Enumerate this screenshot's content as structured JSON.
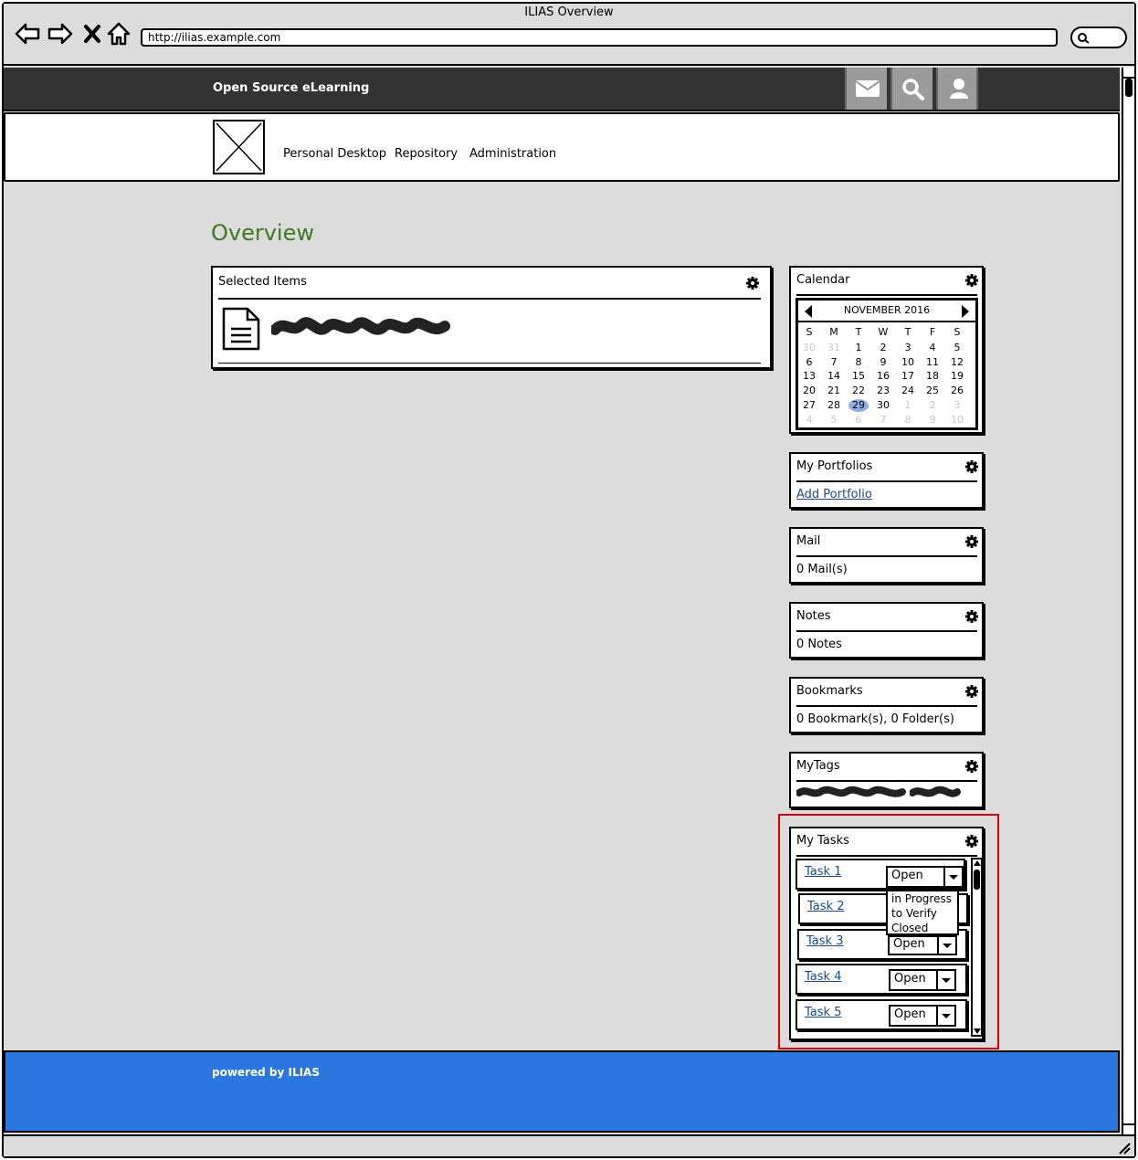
{
  "window": {
    "title": "ILIAS Overview"
  },
  "browser": {
    "url": "http://ilias.example.com"
  },
  "header": {
    "brand": "Open Source eLearning"
  },
  "menu": {
    "items": [
      "Personal Desktop",
      "Repository",
      "Administration"
    ]
  },
  "page": {
    "title": "Overview"
  },
  "selected_items": {
    "title": "Selected Items"
  },
  "calendar": {
    "title": "Calendar",
    "month": "NOVEMBER 2016",
    "weekdays": [
      "S",
      "M",
      "T",
      "W",
      "T",
      "F",
      "S"
    ],
    "weeks": [
      [
        "30",
        "31",
        "1",
        "2",
        "3",
        "4",
        "5"
      ],
      [
        "6",
        "7",
        "8",
        "9",
        "10",
        "11",
        "12"
      ],
      [
        "13",
        "14",
        "15",
        "16",
        "17",
        "18",
        "19"
      ],
      [
        "20",
        "21",
        "22",
        "23",
        "24",
        "25",
        "26"
      ],
      [
        "27",
        "28",
        "29",
        "30",
        "1",
        "2",
        "3"
      ],
      [
        "4",
        "5",
        "6",
        "7",
        "8",
        "9",
        "10"
      ]
    ],
    "today": "29"
  },
  "portfolios": {
    "title": "My Portfolios",
    "link": "Add Portfolio"
  },
  "mail": {
    "title": "Mail",
    "text": "0 Mail(s)"
  },
  "notes": {
    "title": "Notes",
    "text": "0 Notes"
  },
  "bookmarks": {
    "title": "Bookmarks",
    "text": "0 Bookmark(s), 0 Folder(s)"
  },
  "tags": {
    "title": "MyTags"
  },
  "tasks": {
    "title": "My Tasks",
    "items": [
      {
        "name": "Task 1",
        "status": "Open"
      },
      {
        "name": "Task 2",
        "status": ""
      },
      {
        "name": "Task 3",
        "status": "Open"
      },
      {
        "name": "Task 4",
        "status": "Open"
      },
      {
        "name": "Task 5",
        "status": "Open"
      }
    ],
    "dropdown_options": [
      "in Progress",
      "to Verify",
      "Closed"
    ]
  },
  "footer": {
    "text": "powered by ILIAS"
  },
  "colors": {
    "topbar": "#333333",
    "footer": "#2c76e0",
    "accent": "#3e7a1f",
    "highlight": "#e00000"
  }
}
